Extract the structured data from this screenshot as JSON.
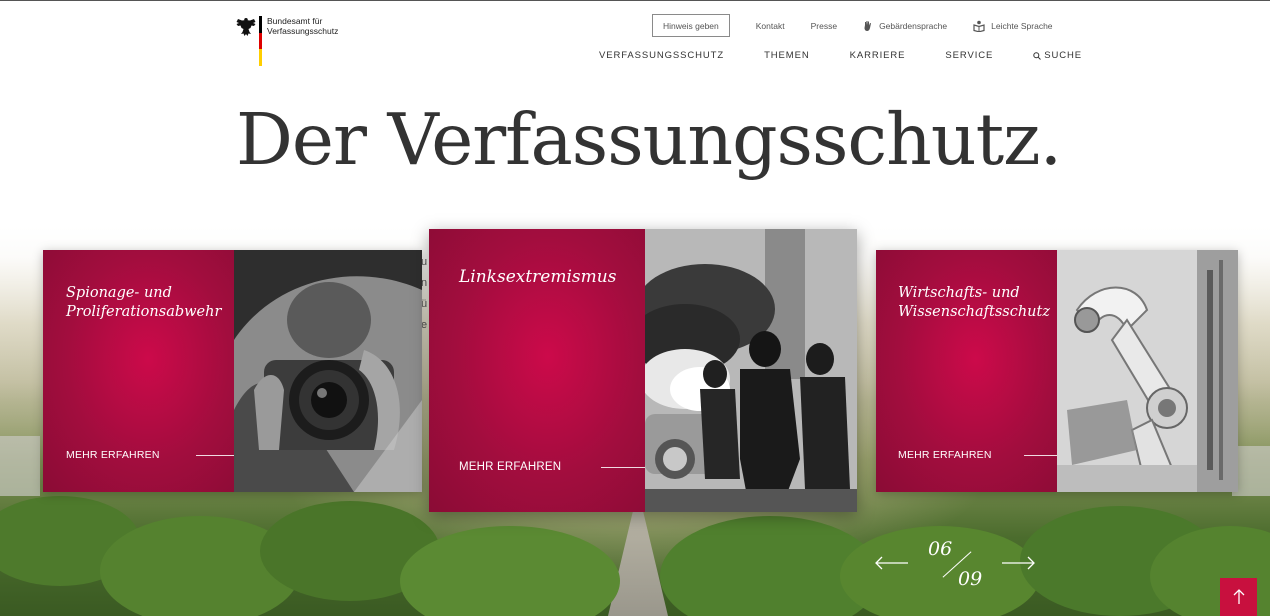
{
  "header": {
    "agency_line1": "Bundesamt für",
    "agency_line2": "Verfassungsschutz",
    "flag_colors": [
      "#000000",
      "#dd0000",
      "#ffce00"
    ]
  },
  "utility_nav": {
    "hinweis": "Hinweis geben",
    "kontakt": "Kontakt",
    "presse": "Presse",
    "gebaerden": "Gebärdensprache",
    "leichte": "Leichte Sprache"
  },
  "main_nav": {
    "verfassungsschutz": "VERFASSUNGSSCHUTZ",
    "themen": "THEMEN",
    "karriere": "KARRIERE",
    "service": "SERVICE",
    "suche": "SUCHE"
  },
  "headline": "Der Verfassungsschutz.",
  "cards": [
    {
      "title_line1": "Spionage- und",
      "title_line2": "Proliferationsabwehr",
      "link": "MEHR ERFAHREN",
      "image": "photographer-with-camera"
    },
    {
      "title_line1": "Linksextremismus",
      "title_line2": "",
      "link": "MEHR ERFAHREN",
      "image": "riot-with-smoke-and-fire"
    },
    {
      "title_line1": "Wirtschafts- und",
      "title_line2": "Wissenschaftsschutz",
      "link": "MEHR ERFAHREN",
      "image": "industrial-robot-arm"
    }
  ],
  "pager": {
    "current": "06",
    "total": "09"
  },
  "colors": {
    "brand": "#b0093f",
    "brand_dark": "#8a0c35",
    "text": "#333333",
    "to_top": "#c8103e"
  }
}
